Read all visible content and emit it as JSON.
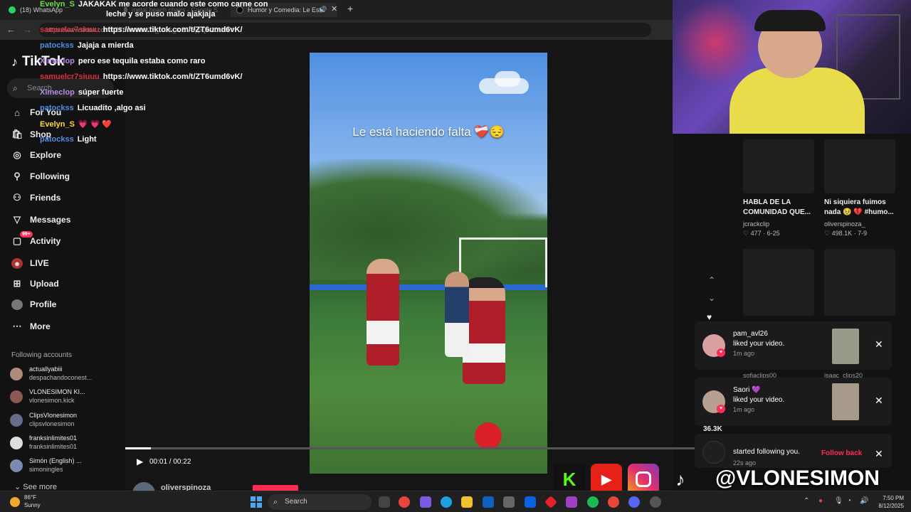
{
  "browser": {
    "tabs": [
      {
        "label": "(18) WhatsApp"
      },
      {
        "label": "metal beach chairs - Google S"
      },
      {
        "label": "Humor y Comedia: Le Está"
      }
    ],
    "new_tab": "+",
    "url": "https://www.tiktok.com/t/ZT6umd6vK/?_r=1&_t=ZT-8ypQw20UrSY"
  },
  "tiktok": {
    "logo": "TikTok",
    "search_placeholder": "Search",
    "nav": [
      {
        "label": "For You",
        "icon": "home-icon"
      },
      {
        "label": "Shop",
        "icon": "shop-icon"
      },
      {
        "label": "Explore",
        "icon": "compass-icon"
      },
      {
        "label": "Following",
        "icon": "following-icon"
      },
      {
        "label": "Friends",
        "icon": "friends-icon"
      },
      {
        "label": "Messages",
        "icon": "messages-icon"
      },
      {
        "label": "Activity",
        "icon": "activity-icon",
        "badge": "99+"
      },
      {
        "label": "LIVE",
        "icon": "live-icon"
      },
      {
        "label": "Upload",
        "icon": "upload-icon"
      },
      {
        "label": "Profile",
        "icon": "profile-icon"
      },
      {
        "label": "More",
        "icon": "more-icon"
      }
    ],
    "following_accounts_title": "Following accounts",
    "following_accounts": [
      {
        "name": "actuallyabiii",
        "sub": "despachandoconest..."
      },
      {
        "name": "VLONESIMON KI...",
        "sub": "vlonesimon.kick"
      },
      {
        "name": "ClipsVlonesimon",
        "sub": "clipsvlonesimon"
      },
      {
        "name": "franksinlimites01",
        "sub": "franksinlimites01"
      },
      {
        "name": "Simón (English) ...",
        "sub": "simoningles"
      }
    ],
    "see_more": "See more",
    "video": {
      "caption": "Le está haciendo falta ❤️‍🩹😔",
      "time": "00:01 / 00:22",
      "progress": 0.045,
      "owner": "oliverspinoza"
    },
    "recommended": [
      {
        "title_line1": "HABLA DE LA",
        "title_line2": "COMUNIDAD QUE...",
        "author": "jcrackclip",
        "stats": "♡ 477 · 6-25"
      },
      {
        "title_line1": "Ni siquiera fuimos",
        "title_line2": "nada 🥹 💔 #humo...",
        "author": "oliverspinoza_",
        "stats": "♡ 498.1K · 7-9"
      }
    ],
    "partial_labels": {
      "left": "sofiaclips00",
      "right": "isaac_clips20",
      "count": "36.3K"
    },
    "notifications": [
      {
        "name": "pam_avl26",
        "message": "liked your video.",
        "time": "1m ago"
      },
      {
        "name": "Saori 💜",
        "message": "liked your video.",
        "time": "1m ago"
      },
      {
        "name": "",
        "message": "started following you.",
        "time": "22s ago",
        "action": "Follow back"
      }
    ]
  },
  "chat": [
    {
      "user": "Evelyn_S",
      "message": "JAKAKAK me acorde cuando este como carne con",
      "color": "#6ddc49"
    },
    {
      "user": "",
      "message": "leche y se puso malo ajakjaja",
      "color": "#6ddc49"
    },
    {
      "user": "samuelcr7siuuu",
      "message": "https://www.tiktok.com/t/ZT6umd6vK/",
      "color": "#e0303a"
    },
    {
      "user": "patockss",
      "message": "Jajaja a mierda",
      "color": "#4f8fe0"
    },
    {
      "user": "Ximeclop",
      "message": "pero ese tequila estaba como raro",
      "color": "#b88be8"
    },
    {
      "user": "samuelcr7siuuu",
      "message": "https://www.tiktok.com/t/ZT6umd6vK/",
      "color": "#e0303a"
    },
    {
      "user": "Ximeclop",
      "message": "súper fuerte",
      "color": "#b88be8"
    },
    {
      "user": "patockss",
      "message": "Licuadito ,algo asi",
      "color": "#4f8fe0"
    },
    {
      "user": "Evelyn_S",
      "message": "💗 💗 ❤️",
      "color": "#ffd93a"
    },
    {
      "user": "patockss",
      "message": "Light",
      "color": "#4f8fe0"
    }
  ],
  "overlay": {
    "handle": "@VLONESIMON",
    "kick": "K"
  },
  "taskbar": {
    "temp": "86°F",
    "weather": "Sunny",
    "search": "Search",
    "time": "7:50 PM",
    "date": "8/12/2025"
  }
}
